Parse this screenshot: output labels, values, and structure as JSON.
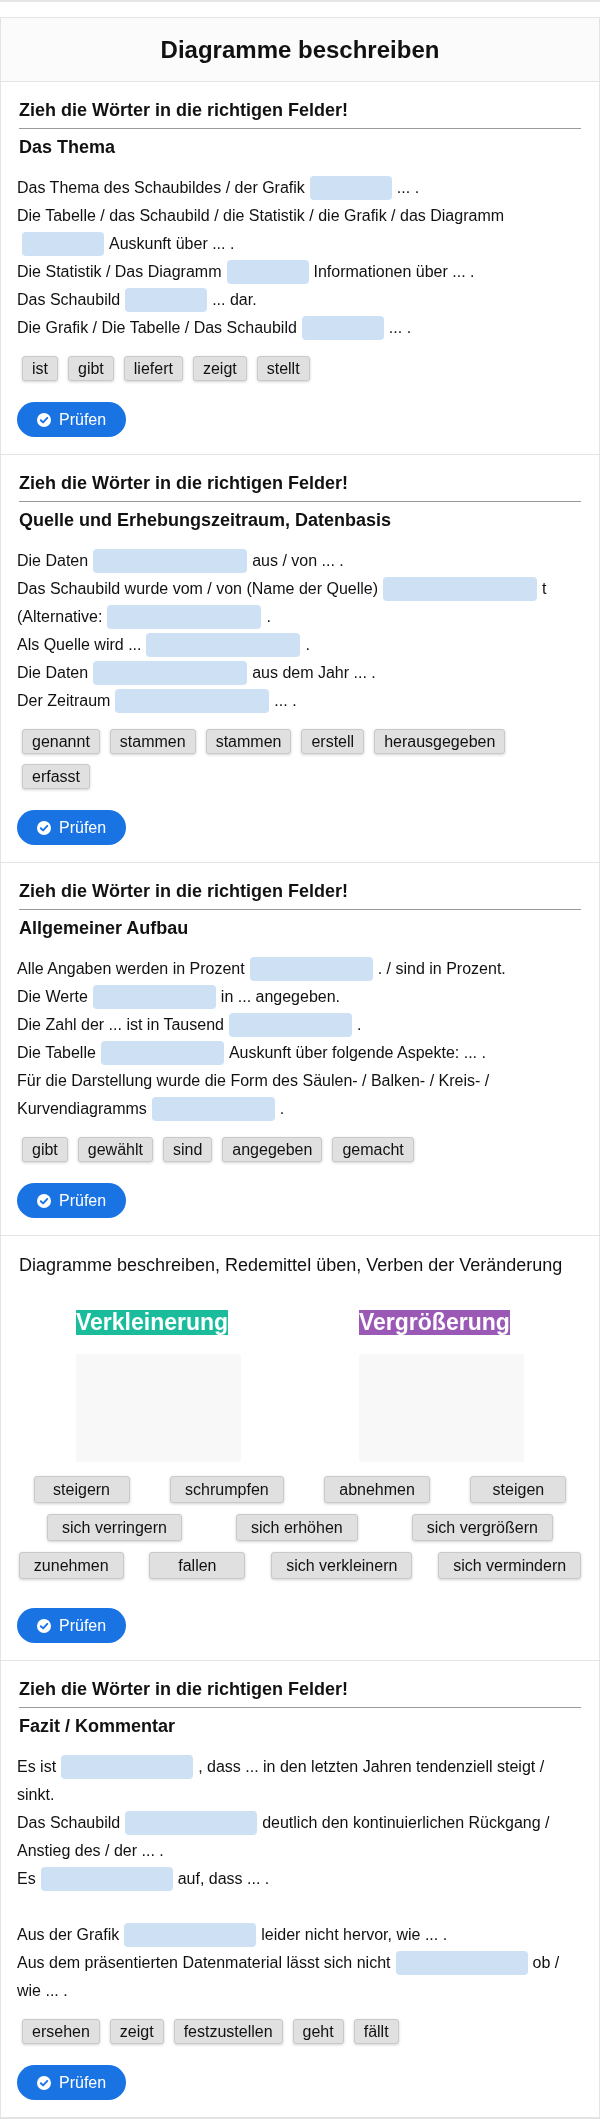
{
  "header": {
    "title": "Diagramme beschreiben"
  },
  "sections": [
    {
      "kind": "cloze",
      "instruction": "Zieh die Wörter in die richtigen Felder!",
      "heading": "Das Thema",
      "paragraphs": [
        {
          "lines": [
            [
              {
                "kind": "text",
                "text": "Das Thema des Schaubildes / der Grafik"
              },
              {
                "kind": "blank"
              },
              {
                "kind": "text",
                "text": "... ."
              }
            ],
            [
              {
                "kind": "text",
                "text": "Die Tabelle / das Schaubild / die Statistik / die Grafik / das Diagramm"
              }
            ],
            [
              {
                "kind": "blank"
              },
              {
                "kind": "text",
                "text": "Auskunft über ... ."
              }
            ],
            [
              {
                "kind": "text",
                "text": "Die Statistik / Das Diagramm"
              },
              {
                "kind": "blank"
              },
              {
                "kind": "text",
                "text": "Informationen über ... ."
              }
            ],
            [
              {
                "kind": "text",
                "text": "Das Schaubild"
              },
              {
                "kind": "blank"
              },
              {
                "kind": "text",
                "text": "... dar."
              }
            ],
            [
              {
                "kind": "text",
                "text": "Die Grafik / Die Tabelle / Das Schaubild"
              },
              {
                "kind": "blank"
              },
              {
                "kind": "text",
                "text": "... ."
              }
            ]
          ]
        }
      ],
      "words": [
        "ist",
        "gibt",
        "liefert",
        "zeigt",
        "stellt"
      ],
      "check_button": "Prüfen"
    },
    {
      "kind": "cloze",
      "instruction": "Zieh die Wörter in die richtigen Felder!",
      "heading": "Quelle und Erhebungszeitraum, Datenbasis",
      "paragraphs": [
        {
          "lines": [
            [
              {
                "kind": "text",
                "text": "Die Daten"
              },
              {
                "kind": "blank"
              },
              {
                "kind": "text",
                "text": "aus / von ... ."
              }
            ],
            [
              {
                "kind": "text",
                "text": "Das Schaubild wurde vom / von (Name der Quelle)"
              },
              {
                "kind": "blank"
              },
              {
                "kind": "text",
                "text": "t"
              }
            ],
            [
              {
                "kind": "text",
                "text": "(Alternative:"
              },
              {
                "kind": "blank"
              },
              {
                "kind": "text",
                "text": "."
              }
            ],
            [
              {
                "kind": "text",
                "text": "Als Quelle wird ..."
              },
              {
                "kind": "blank"
              },
              {
                "kind": "text",
                "text": "."
              }
            ],
            [
              {
                "kind": "text",
                "text": "Die Daten"
              },
              {
                "kind": "blank"
              },
              {
                "kind": "text",
                "text": "aus dem Jahr ... ."
              }
            ],
            [
              {
                "kind": "text",
                "text": "Der Zeitraum"
              },
              {
                "kind": "blank"
              },
              {
                "kind": "text",
                "text": "... ."
              }
            ]
          ]
        }
      ],
      "words": [
        "genannt",
        "stammen",
        "stammen",
        "erstell",
        "herausgegeben",
        "erfasst"
      ],
      "check_button": "Prüfen"
    },
    {
      "kind": "cloze",
      "instruction": "Zieh die Wörter in die richtigen Felder!",
      "heading": "Allgemeiner Aufbau",
      "paragraphs": [
        {
          "lines": [
            [
              {
                "kind": "text",
                "text": "Alle Angaben werden in Prozent"
              },
              {
                "kind": "blank"
              },
              {
                "kind": "text",
                "text": ". / sind in Prozent."
              }
            ],
            [
              {
                "kind": "text",
                "text": "Die Werte"
              },
              {
                "kind": "blank"
              },
              {
                "kind": "text",
                "text": "in ... angegeben."
              }
            ],
            [
              {
                "kind": "text",
                "text": "Die Zahl der ... ist in Tausend"
              },
              {
                "kind": "blank"
              },
              {
                "kind": "text",
                "text": "."
              }
            ],
            [
              {
                "kind": "text",
                "text": "Die Tabelle"
              },
              {
                "kind": "blank"
              },
              {
                "kind": "text",
                "text": "Auskunft über folgende Aspekte: ... ."
              }
            ],
            [
              {
                "kind": "text",
                "text": "Für die Darstellung wurde die Form des Säulen- / Balken- / Kreis- /"
              }
            ],
            [
              {
                "kind": "text",
                "text": "Kurvendiagramms"
              },
              {
                "kind": "blank"
              },
              {
                "kind": "text",
                "text": "."
              }
            ]
          ]
        }
      ],
      "words": [
        "gibt",
        "gewählt",
        "sind",
        "angegeben",
        "gemacht"
      ],
      "check_button": "Prüfen"
    },
    {
      "kind": "sort",
      "instruction": "Diagramme beschreiben, Redemittel üben, Verben der Veränderung",
      "groups": [
        {
          "label": "Verkleinerung",
          "color": "#1abc9c"
        },
        {
          "label": "Vergrößerung",
          "color": "#9b59b6"
        }
      ],
      "words": [
        "steigern",
        "schrumpfen",
        "abnehmen",
        "steigen",
        "sich verringern",
        "sich erhöhen",
        "sich vergrößern",
        "zunehmen",
        "fallen",
        "sich verkleinern",
        "sich vermindern"
      ],
      "check_button": "Prüfen"
    },
    {
      "kind": "cloze",
      "instruction": "Zieh die Wörter in die richtigen Felder!",
      "heading": "Fazit / Kommentar",
      "paragraphs": [
        {
          "lines": [
            [
              {
                "kind": "text",
                "text": "Es ist"
              },
              {
                "kind": "blank"
              },
              {
                "kind": "text",
                "text": ", dass ... in den letzten Jahren tendenziell steigt /"
              }
            ],
            [
              {
                "kind": "text",
                "text": "sinkt."
              }
            ],
            [
              {
                "kind": "text",
                "text": "Das Schaubild"
              },
              {
                "kind": "blank"
              },
              {
                "kind": "text",
                "text": "deutlich den kontinuierlichen Rückgang /"
              }
            ],
            [
              {
                "kind": "text",
                "text": "Anstieg des / der ... ."
              }
            ],
            [
              {
                "kind": "text",
                "text": "Es"
              },
              {
                "kind": "blank"
              },
              {
                "kind": "text",
                "text": "auf, dass ... ."
              }
            ]
          ]
        },
        {
          "lines": [
            [
              {
                "kind": "text",
                "text": "Aus der Grafik"
              },
              {
                "kind": "blank"
              },
              {
                "kind": "text",
                "text": "leider nicht hervor, wie ... ."
              }
            ],
            [
              {
                "kind": "text",
                "text": "Aus dem präsentierten Datenmaterial lässt sich nicht"
              },
              {
                "kind": "blank"
              },
              {
                "kind": "text",
                "text": "ob /"
              }
            ],
            [
              {
                "kind": "text",
                "text": "wie ... ."
              }
            ]
          ]
        }
      ],
      "words": [
        "ersehen",
        "zeigt",
        "festzustellen",
        "geht",
        "fällt"
      ],
      "check_button": "Prüfen"
    }
  ]
}
